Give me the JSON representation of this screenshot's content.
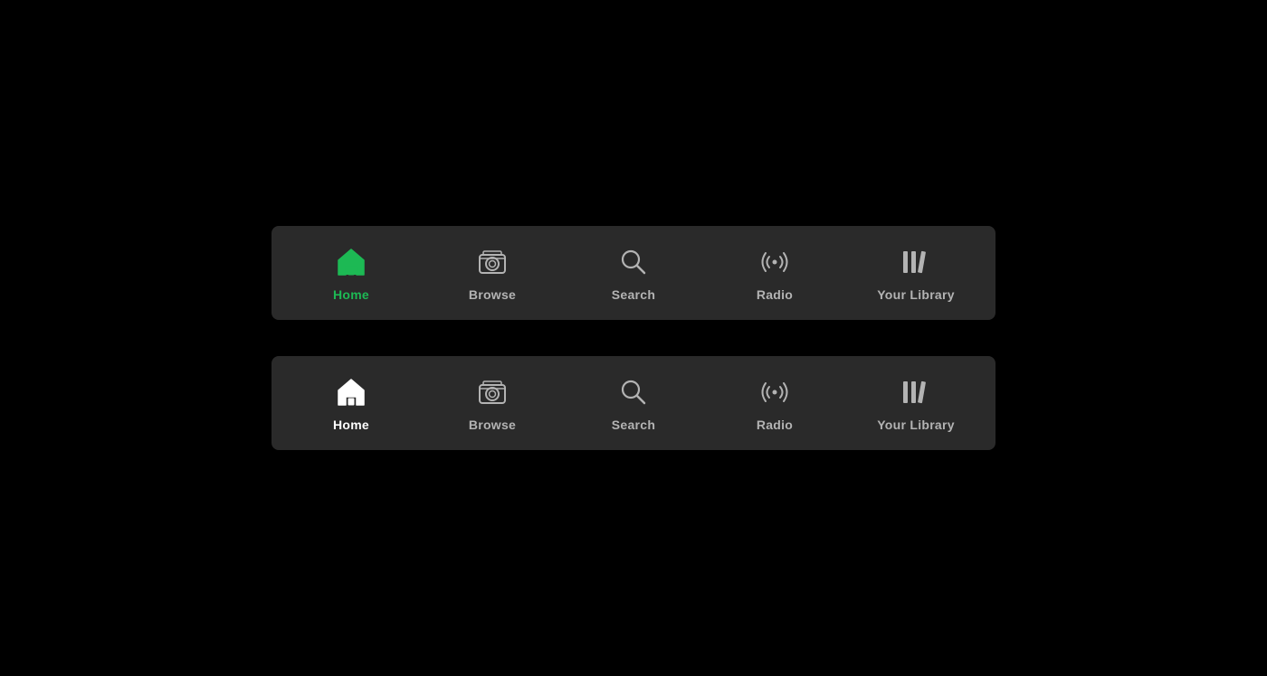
{
  "bars": [
    {
      "id": "top",
      "variant": "green-active",
      "items": [
        {
          "id": "home",
          "label": "Home",
          "active": true
        },
        {
          "id": "browse",
          "label": "Browse",
          "active": false
        },
        {
          "id": "search",
          "label": "Search",
          "active": false
        },
        {
          "id": "radio",
          "label": "Radio",
          "active": false
        },
        {
          "id": "library",
          "label": "Your Library",
          "active": false
        }
      ]
    },
    {
      "id": "bottom",
      "variant": "white-active",
      "items": [
        {
          "id": "home",
          "label": "Home",
          "active": true
        },
        {
          "id": "browse",
          "label": "Browse",
          "active": false
        },
        {
          "id": "search",
          "label": "Search",
          "active": false
        },
        {
          "id": "radio",
          "label": "Radio",
          "active": false
        },
        {
          "id": "library",
          "label": "Your Library",
          "active": false
        }
      ]
    }
  ],
  "colors": {
    "active_green": "#1db954",
    "active_white": "#ffffff",
    "inactive": "#b3b3b3",
    "bg": "#2a2a2a"
  }
}
